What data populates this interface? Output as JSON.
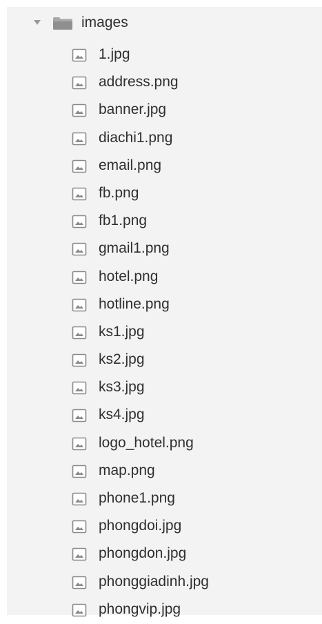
{
  "folder": {
    "name": "images",
    "expanded": true,
    "icon": "folder-icon",
    "toggle_icon": "caret-down-icon"
  },
  "files": [
    {
      "name": "1.jpg",
      "icon": "image-file-icon"
    },
    {
      "name": "address.png",
      "icon": "image-file-icon"
    },
    {
      "name": "banner.jpg",
      "icon": "image-file-icon"
    },
    {
      "name": "diachi1.png",
      "icon": "image-file-icon"
    },
    {
      "name": "email.png",
      "icon": "image-file-icon"
    },
    {
      "name": "fb.png",
      "icon": "image-file-icon"
    },
    {
      "name": "fb1.png",
      "icon": "image-file-icon"
    },
    {
      "name": "gmail1.png",
      "icon": "image-file-icon"
    },
    {
      "name": "hotel.png",
      "icon": "image-file-icon"
    },
    {
      "name": "hotline.png",
      "icon": "image-file-icon"
    },
    {
      "name": "ks1.jpg",
      "icon": "image-file-icon"
    },
    {
      "name": "ks2.jpg",
      "icon": "image-file-icon"
    },
    {
      "name": "ks3.jpg",
      "icon": "image-file-icon"
    },
    {
      "name": "ks4.jpg",
      "icon": "image-file-icon"
    },
    {
      "name": "logo_hotel.png",
      "icon": "image-file-icon"
    },
    {
      "name": "map.png",
      "icon": "image-file-icon"
    },
    {
      "name": "phone1.png",
      "icon": "image-file-icon"
    },
    {
      "name": "phongdoi.jpg",
      "icon": "image-file-icon"
    },
    {
      "name": "phongdon.jpg",
      "icon": "image-file-icon"
    },
    {
      "name": "phonggiadinh.jpg",
      "icon": "image-file-icon"
    },
    {
      "name": "phongvip.jpg",
      "icon": "image-file-icon"
    }
  ],
  "colors": {
    "panel_background": "#f3f3f3",
    "text": "#2f2f2f",
    "icon_stroke": "#8a8a8a",
    "folder_fill": "#9e9e9e"
  }
}
